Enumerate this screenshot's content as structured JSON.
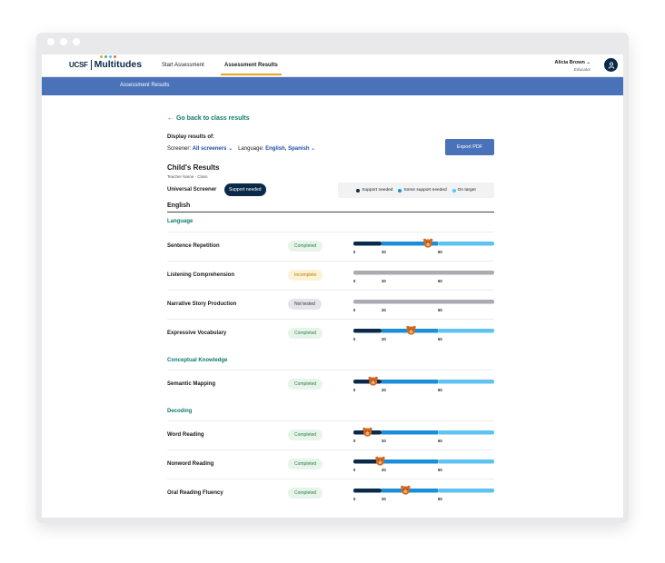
{
  "nav": {
    "logo_ucsf": "UCSF",
    "logo_name": "Multitudes",
    "links": [
      "Start Assessment",
      "Assessment Results"
    ],
    "active_index": 1,
    "user_name": "Alicia Brown",
    "user_role": "Educator"
  },
  "banner": {
    "title": "Assessment Results"
  },
  "page": {
    "back_link": "Go back to class results",
    "display_label": "Display results of:",
    "screener_label": "Screener:",
    "screener_value": "All screeners",
    "language_label": "Language:",
    "language_value": "English, Spanish",
    "export_label": "Export PDF",
    "child_title": "Child's Results",
    "child_sub": "Teacher Name · Class",
    "universal_label": "Universal Screener",
    "universal_status": "Support needed",
    "legend": [
      {
        "label": "Support needed",
        "color": "#0b2a4a"
      },
      {
        "label": "Some support needed",
        "color": "#1a8fd8"
      },
      {
        "label": "On target",
        "color": "#5ec2f2"
      }
    ],
    "language_heading": "English",
    "sections": [
      {
        "title": "Language",
        "rows": [
          {
            "label": "Sentence Repetition",
            "status": "Completed",
            "status_type": "completed",
            "score": 53
          },
          {
            "label": "Listening Comprehension",
            "status": "Incomplete",
            "status_type": "incomplete",
            "score": null
          },
          {
            "label": "Narrative Story Production",
            "status": "Not tested",
            "status_type": "nottested",
            "score": null
          },
          {
            "label": "Expressive Vocabulary",
            "status": "Completed",
            "status_type": "completed",
            "score": 41
          }
        ]
      },
      {
        "title": "Conceptual Knowledge",
        "rows": [
          {
            "label": "Semantic Mapping",
            "status": "Completed",
            "status_type": "completed",
            "score": 14
          }
        ]
      },
      {
        "title": "Decoding",
        "rows": [
          {
            "label": "Word Reading",
            "status": "Completed",
            "status_type": "completed",
            "score": 10
          },
          {
            "label": "Nonword Reading",
            "status": "Completed",
            "status_type": "completed",
            "score": 19
          },
          {
            "label": "Oral Reading Fluency",
            "status": "Completed",
            "status_type": "completed",
            "score": 37
          }
        ]
      }
    ],
    "scale": {
      "ticks": [
        "0",
        "20",
        "60"
      ],
      "tick_values": [
        0,
        20,
        60
      ],
      "max": 100
    },
    "colors": {
      "support": "#0b2a4a",
      "some": "#1a8fd8",
      "target": "#5ec2f2",
      "gray": "#a9abb0",
      "bear": "#d2691e",
      "teal": "#0d7a6a",
      "accent": "#e8a51d"
    }
  }
}
